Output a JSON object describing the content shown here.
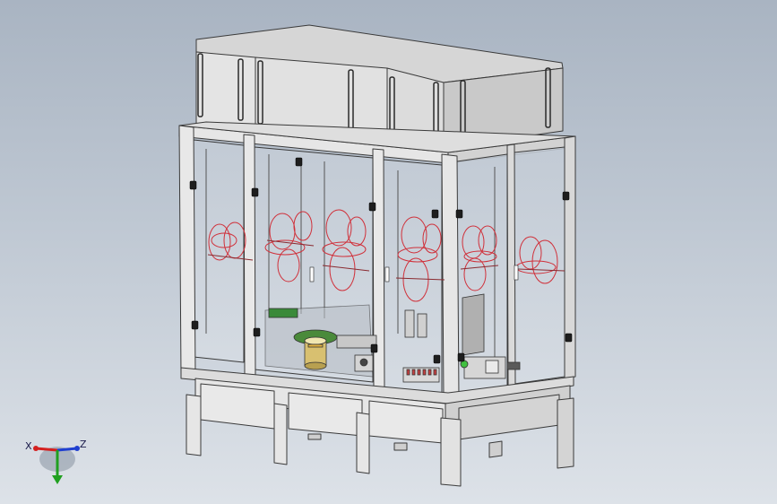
{
  "viewport": {
    "background_top": "#a9b4c2",
    "background_bottom": "#dde2e8"
  },
  "model": {
    "frame_color": "#e4e4e4",
    "edge_color": "#3a3a3a",
    "glass_color": "#c9d2dc",
    "coil_color": "#d0303a",
    "handle_color": "#d8d8d8"
  },
  "triad": {
    "x_label": "X",
    "z_label": "Z",
    "x_color": "#d42020",
    "y_color": "#20a020",
    "z_color": "#2040d0",
    "icon": "coordinate-triad-icon"
  }
}
